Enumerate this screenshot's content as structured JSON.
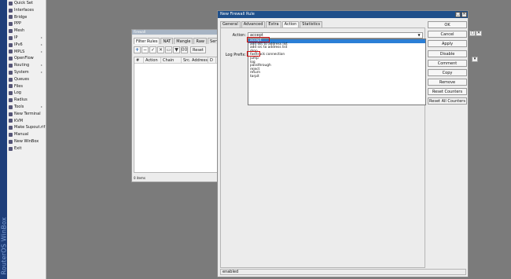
{
  "brand": "RouterOS WinBox",
  "menu": [
    {
      "label": "Quick Set",
      "icon": "quick-set-icon",
      "arrow": false
    },
    {
      "label": "Interfaces",
      "icon": "interfaces-icon",
      "arrow": false
    },
    {
      "label": "Bridge",
      "icon": "bridge-icon",
      "arrow": false
    },
    {
      "label": "PPP",
      "icon": "ppp-icon",
      "arrow": false
    },
    {
      "label": "Mesh",
      "icon": "mesh-icon",
      "arrow": false
    },
    {
      "label": "IP",
      "icon": "ip-icon",
      "arrow": true
    },
    {
      "label": "IPv6",
      "icon": "ipv6-icon",
      "arrow": true
    },
    {
      "label": "MPLS",
      "icon": "mpls-icon",
      "arrow": true
    },
    {
      "label": "OpenFlow",
      "icon": "openflow-icon",
      "arrow": false
    },
    {
      "label": "Routing",
      "icon": "routing-icon",
      "arrow": true
    },
    {
      "label": "System",
      "icon": "system-icon",
      "arrow": true
    },
    {
      "label": "Queues",
      "icon": "queues-icon",
      "arrow": false
    },
    {
      "label": "Files",
      "icon": "files-icon",
      "arrow": false
    },
    {
      "label": "Log",
      "icon": "log-icon",
      "arrow": false
    },
    {
      "label": "Radius",
      "icon": "radius-icon",
      "arrow": false
    },
    {
      "label": "Tools",
      "icon": "tools-icon",
      "arrow": true
    },
    {
      "label": "New Terminal",
      "icon": "terminal-icon",
      "arrow": false
    },
    {
      "label": "KVM",
      "icon": "kvm-icon",
      "arrow": false
    },
    {
      "label": "Make Supout.rif",
      "icon": "supout-icon",
      "arrow": false
    },
    {
      "label": "Manual",
      "icon": "manual-icon",
      "arrow": false
    },
    {
      "label": "New WinBox",
      "icon": "winbox-icon",
      "arrow": false
    },
    {
      "label": "Exit",
      "icon": "exit-icon",
      "arrow": false
    }
  ],
  "firewall": {
    "title": "Firewall",
    "tabs": [
      "Filter Rules",
      "NAT",
      "Mangle",
      "Raw",
      "Service Por"
    ],
    "reset_label": "Reset",
    "columns": [
      "#",
      "Action",
      "Chain",
      "Src. Address",
      "D"
    ],
    "status": "0 items"
  },
  "dialog": {
    "title": "New Firewall Rule",
    "tabs": [
      "General",
      "Advanced",
      "Extra",
      "Action",
      "Statistics"
    ],
    "active_tab": "Action",
    "action_label": "Action:",
    "action_value": "accept",
    "log_prefix_label": "Log Prefix:",
    "options": [
      "accept",
      "add dst to address list",
      "add src to address list",
      "drop",
      "fasttrack connection",
      "jump",
      "log",
      "passthrough",
      "reject",
      "return",
      "tarpit"
    ],
    "selected_option": "accept",
    "status": "enabled",
    "buttons": [
      "OK",
      "Cancel",
      "Apply",
      "Disable",
      "Comment",
      "Copy",
      "Remove",
      "Reset Counters",
      "Reset All Counters"
    ]
  }
}
